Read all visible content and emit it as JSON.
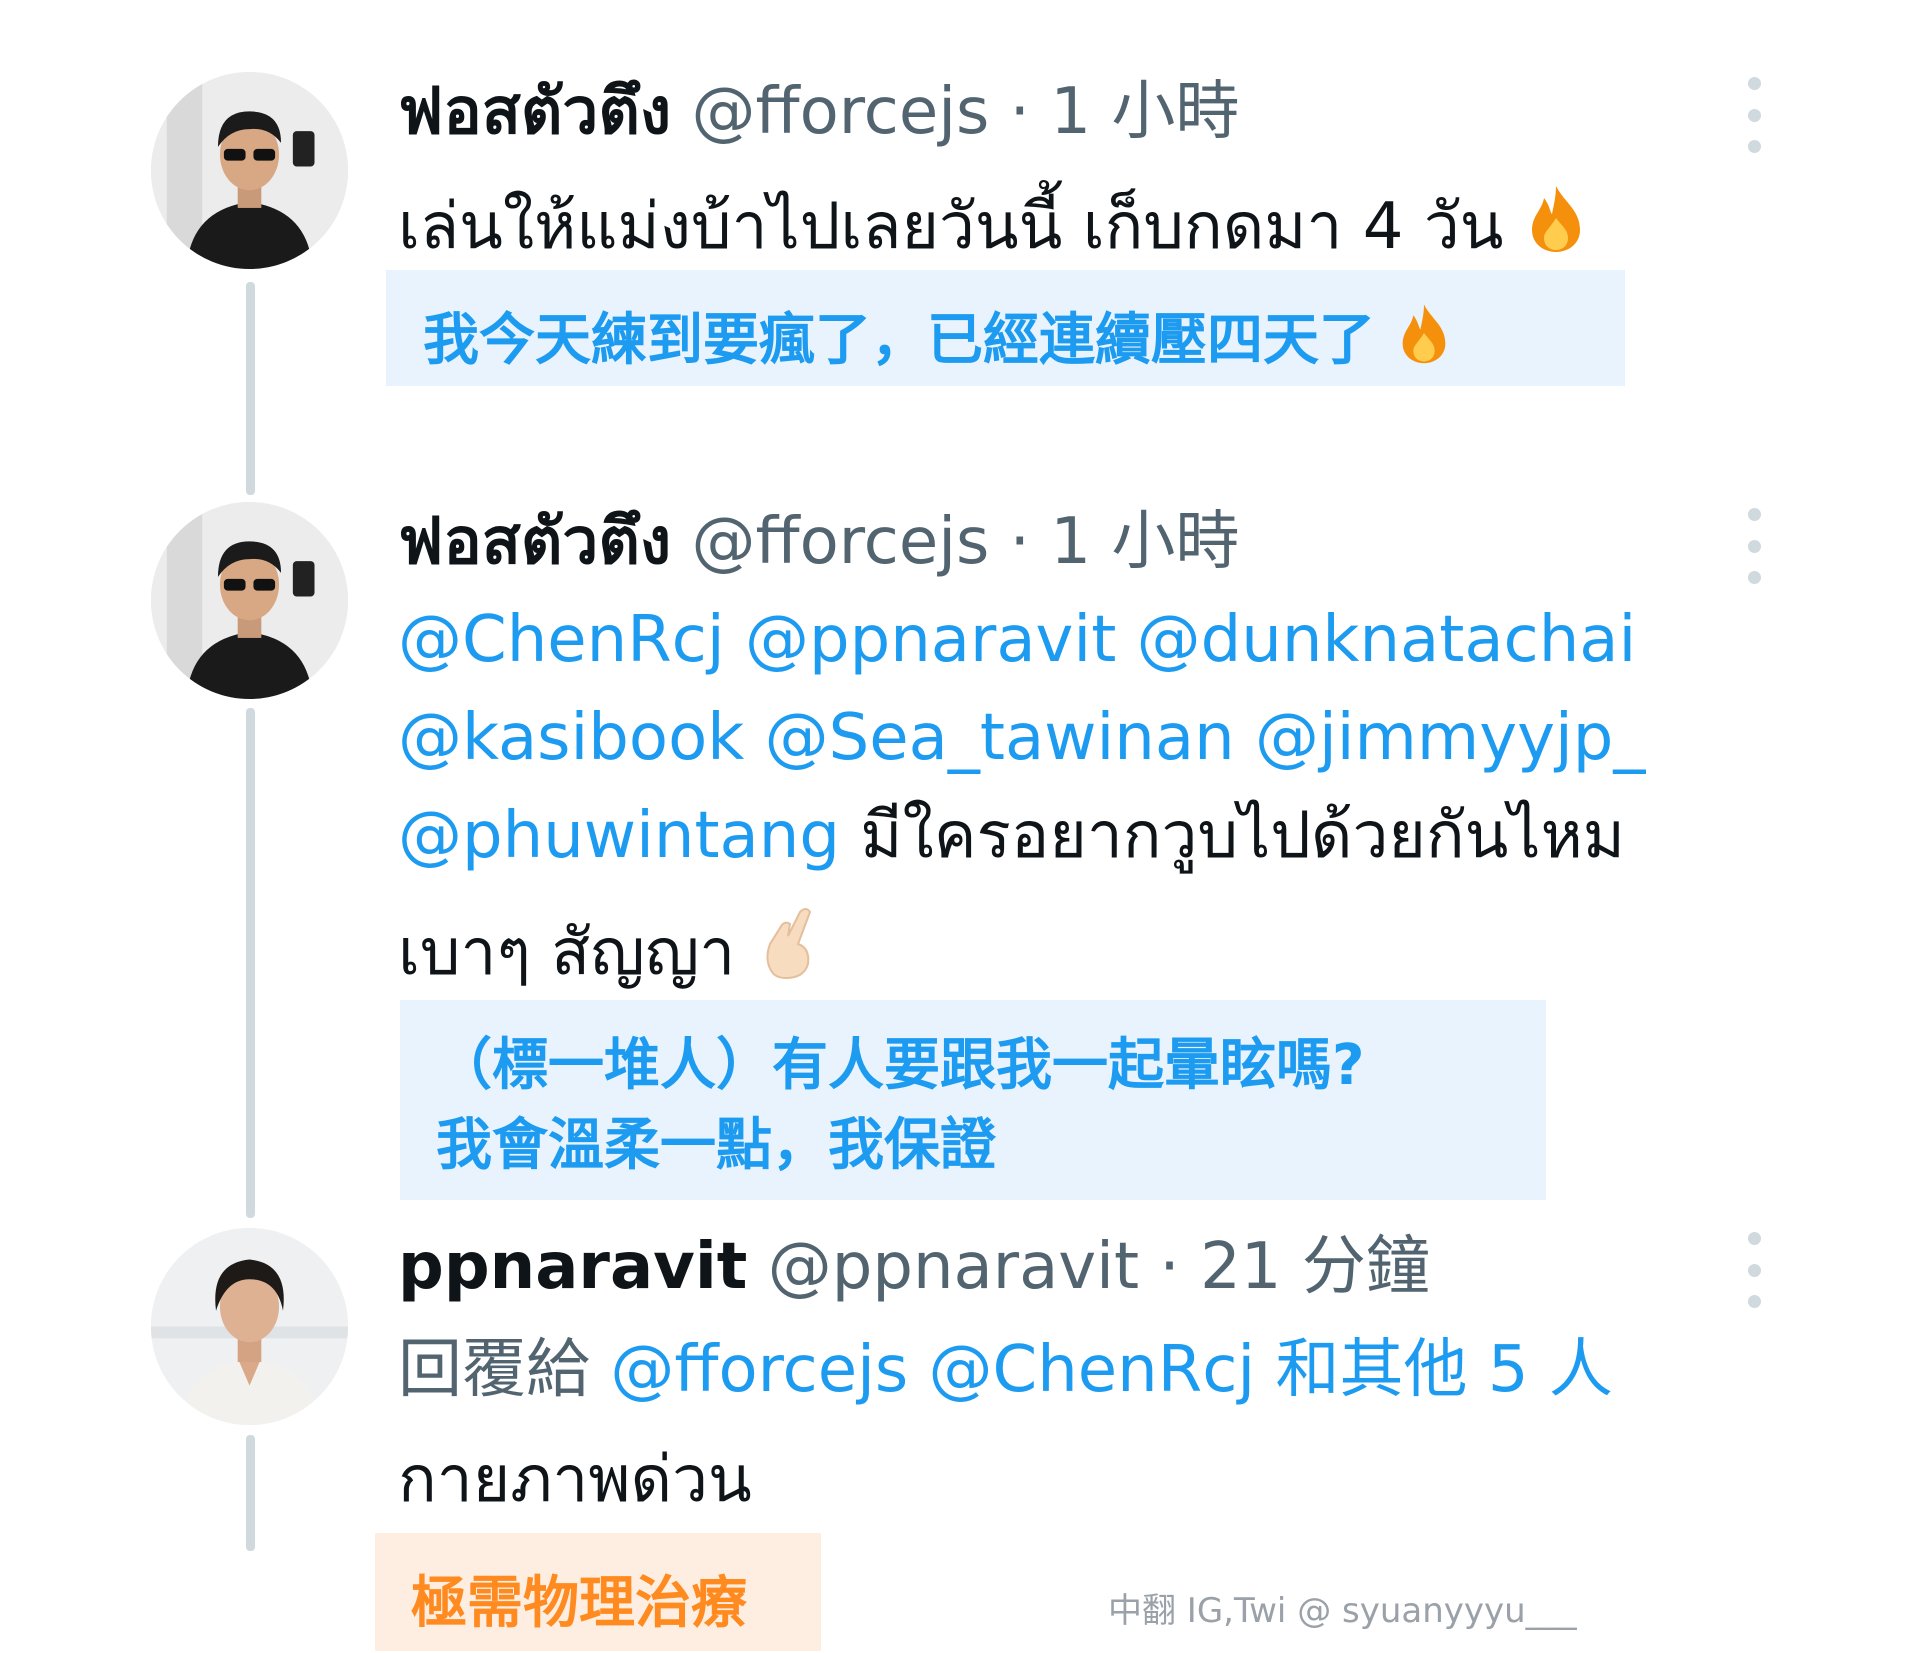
{
  "tweets": [
    {
      "name": "ฟอสตัวตึง",
      "handle": "@fforcejs",
      "time_sep": " · ",
      "time": "1 小時",
      "text": "เล่นให้แม่งบ้าไปเลยวันนี้ เก็บกดมา 4 วัน",
      "text_emoji": "fire-icon",
      "translation": "我今天練到要瘋了，已經連續壓四天了",
      "translation_emoji": "fire-icon"
    },
    {
      "name": "ฟอสตัวตึง",
      "handle": "@fforcejs",
      "time_sep": " · ",
      "time": "1 小時",
      "mentions_line1": "@ChenRcj @ppnaravit @dunknatachai",
      "mentions_line2": "@kasibook @Sea_tawinan @jimmyyjp_",
      "mention_line3": "@phuwintang",
      "text_line3": " มีใครอยากวูบไปด้วยกันไหม",
      "text_line4": "เบาๆ  สัญญา",
      "text_emoji": "crossed-fingers-icon",
      "translation_line1": "（標一堆人）有人要跟我一起暈眩嗎?",
      "translation_line2": "我會溫柔一點，我保證"
    },
    {
      "name": "ppnaravit",
      "handle": "@ppnaravit",
      "time_sep": " · ",
      "time": "21 分鐘",
      "reply_prefix": "回覆給 ",
      "reply_mentions": "@fforcejs @ChenRcj 和其他 5 人",
      "text": "กายภาพด่วน",
      "translation": "極需物理治療"
    }
  ],
  "credit": "中翻 IG,Twi @ syuanyyyu___",
  "colors": {
    "mention": "#1d9bf0",
    "translation_bg": "#e8f3fd",
    "orange_text": "#ff8a1f",
    "orange_bg": "#fdeee1",
    "meta": "#536471"
  }
}
